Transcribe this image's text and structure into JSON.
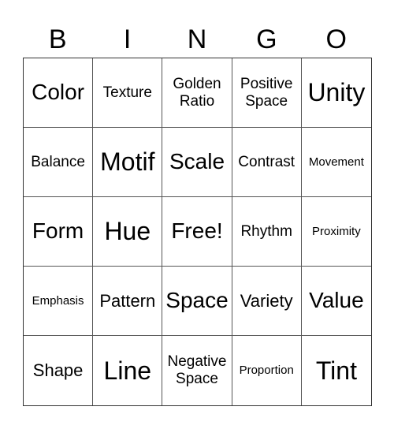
{
  "header": [
    "B",
    "I",
    "N",
    "G",
    "O"
  ],
  "cells": [
    {
      "text": "Color",
      "size": "s-l"
    },
    {
      "text": "Texture",
      "size": "s-s"
    },
    {
      "text": "Golden Ratio",
      "size": "s-s"
    },
    {
      "text": "Positive Space",
      "size": "s-s"
    },
    {
      "text": "Unity",
      "size": "s-xl"
    },
    {
      "text": "Balance",
      "size": "s-s"
    },
    {
      "text": "Motif",
      "size": "s-xl"
    },
    {
      "text": "Scale",
      "size": "s-l"
    },
    {
      "text": "Contrast",
      "size": "s-s"
    },
    {
      "text": "Movement",
      "size": "s-xs"
    },
    {
      "text": "Form",
      "size": "s-l"
    },
    {
      "text": "Hue",
      "size": "s-xl"
    },
    {
      "text": "Free!",
      "size": "s-l"
    },
    {
      "text": "Rhythm",
      "size": "s-s"
    },
    {
      "text": "Proximity",
      "size": "s-xs"
    },
    {
      "text": "Emphasis",
      "size": "s-xs"
    },
    {
      "text": "Pattern",
      "size": "s-m"
    },
    {
      "text": "Space",
      "size": "s-l"
    },
    {
      "text": "Variety",
      "size": "s-m"
    },
    {
      "text": "Value",
      "size": "s-l"
    },
    {
      "text": "Shape",
      "size": "s-m"
    },
    {
      "text": "Line",
      "size": "s-xl"
    },
    {
      "text": "Negative Space",
      "size": "s-s"
    },
    {
      "text": "Proportion",
      "size": "s-xs"
    },
    {
      "text": "Tint",
      "size": "s-xl"
    }
  ]
}
